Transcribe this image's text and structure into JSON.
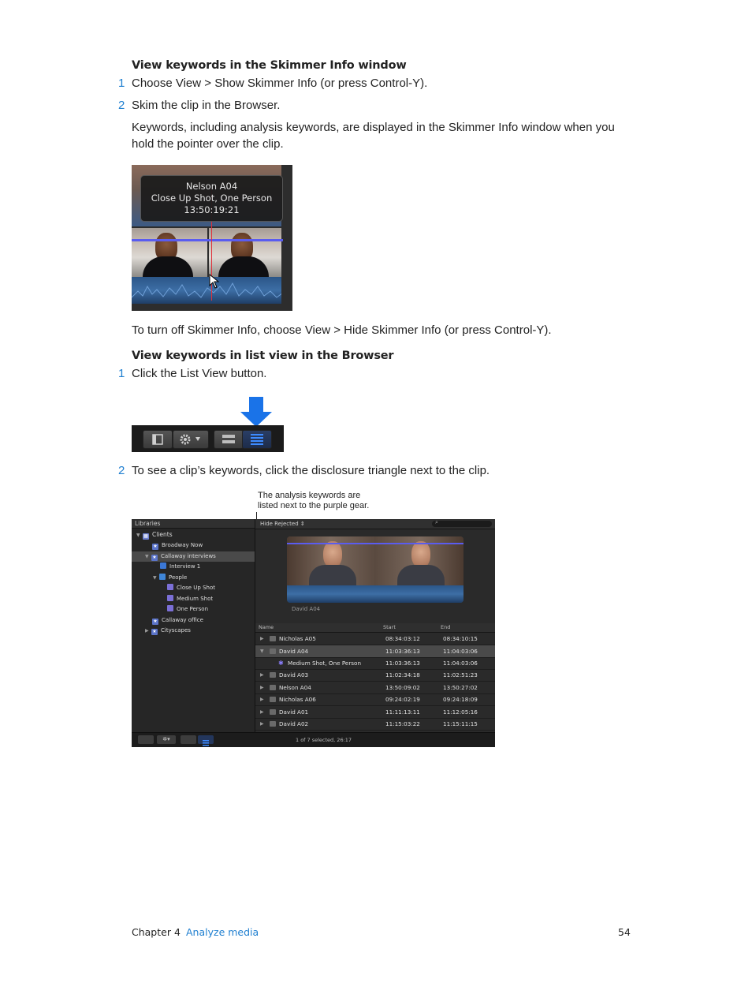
{
  "section1": {
    "heading": "View keywords in the Skimmer Info window",
    "steps": [
      {
        "num": "1",
        "text": "Choose View > Show Skimmer Info (or press Control-Y)."
      },
      {
        "num": "2",
        "text": "Skim the clip in the Browser."
      }
    ],
    "note_line1": "Keywords, including analysis keywords, are displayed in the Skimmer Info window when you",
    "note_line2": "hold the pointer over the clip.",
    "tooltip": {
      "line1": "Nelson A04",
      "line2": "Close Up Shot, One Person",
      "line3": "13:50:19:21"
    },
    "after": "To turn off Skimmer Info, choose View > Hide Skimmer Info (or press Control-Y)."
  },
  "section2": {
    "heading": "View keywords in list view in the Browser",
    "step1": {
      "num": "1",
      "text": "Click the List View button."
    },
    "step2": {
      "num": "2",
      "text": "To see a clip’s keywords, click the disclosure triangle next to the clip."
    }
  },
  "callout": {
    "line1": "The analysis keywords are",
    "line2": "listed next to the purple gear."
  },
  "browser": {
    "libraries_label": "Libraries",
    "library_items": [
      {
        "label": "Clients"
      },
      {
        "label": "Broadway Now"
      },
      {
        "label": "Callaway interviews"
      },
      {
        "label": "Interview 1"
      },
      {
        "label": "People"
      },
      {
        "label": "Close Up Shot"
      },
      {
        "label": "Medium Shot"
      },
      {
        "label": "One Person"
      },
      {
        "label": "Callaway office"
      },
      {
        "label": "Cityscapes"
      }
    ],
    "filter_label": "Hide Rejected",
    "clip_name": "David A04",
    "columns": {
      "name": "Name",
      "start": "Start",
      "end": "End"
    },
    "rows": [
      {
        "name": "Nicholas A05",
        "start": "08:34:03:12",
        "end": "08:34:10:15"
      },
      {
        "name": "David A04",
        "start": "11:03:36:13",
        "end": "11:04:03:06"
      },
      {
        "name": "Medium Shot, One Person",
        "start": "11:03:36:13",
        "end": "11:04:03:06"
      },
      {
        "name": "David A03",
        "start": "11:02:34:18",
        "end": "11:02:51:23"
      },
      {
        "name": "Nelson A04",
        "start": "13:50:09:02",
        "end": "13:50:27:02"
      },
      {
        "name": "Nicholas A06",
        "start": "09:24:02:19",
        "end": "09:24:18:09"
      },
      {
        "name": "David A01",
        "start": "11:11:13:11",
        "end": "11:12:05:16"
      },
      {
        "name": "David A02",
        "start": "11:15:03:22",
        "end": "11:15:11:15"
      }
    ],
    "status": "1 of 7 selected, 26:17"
  },
  "footer": {
    "chapter": "Chapter 4",
    "chapter_title": "Analyze media",
    "page": "54"
  },
  "colors": {
    "accent": "#1f7fd0",
    "playhead": "#e0303a",
    "skimmer_line": "#5a5cf0",
    "arrow": "#1a73e8"
  }
}
